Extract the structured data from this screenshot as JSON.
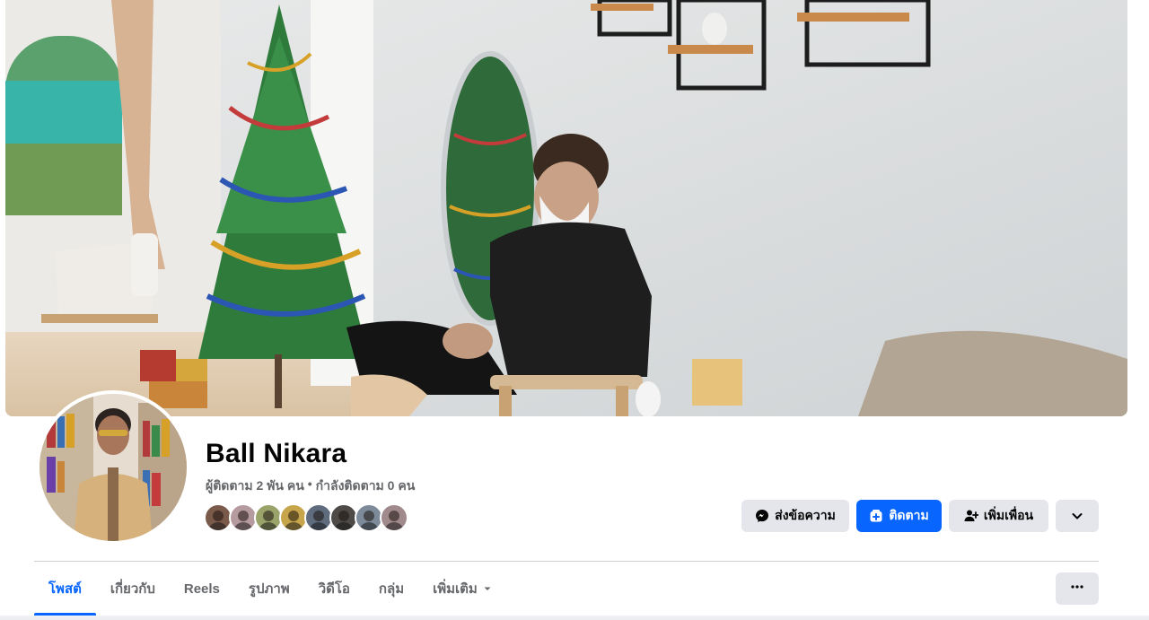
{
  "profile": {
    "name": "Ball Nikara",
    "followers": "ผู้ติดตาม 2 พัน คน",
    "separator": "•",
    "following": "กำลังติดตาม 0 คน"
  },
  "friend_avatars": [
    {
      "color": "#7a5a4a"
    },
    {
      "color": "#b59a9f"
    },
    {
      "color": "#9aa36a"
    },
    {
      "color": "#c7a54a"
    },
    {
      "color": "#5e6c7e"
    },
    {
      "color": "#4d4a48"
    },
    {
      "color": "#7d8a9a"
    },
    {
      "color": "#a08a8c"
    }
  ],
  "actions": {
    "message_label": "ส่งข้อความ",
    "follow_label": "ติดตาม",
    "add_friend_label": "เพิ่มเพื่อน"
  },
  "tabs": [
    {
      "label": "โพสต์",
      "active": true
    },
    {
      "label": "เกี่ยวกับ",
      "active": false
    },
    {
      "label": "Reels",
      "active": false
    },
    {
      "label": "รูปภาพ",
      "active": false
    },
    {
      "label": "วิดีโอ",
      "active": false
    },
    {
      "label": "กลุ่ม",
      "active": false
    },
    {
      "label": "เพิ่มเติม",
      "active": false
    }
  ],
  "icons": {
    "message": "messenger-icon",
    "follow": "follow-icon",
    "add_friend": "add-friend-icon",
    "chevron": "chevron-down-icon",
    "more": "more-dots-icon",
    "caret": "caret-down-icon"
  },
  "colors": {
    "primary": "#0866ff",
    "secondary_bg": "#e4e6eb",
    "secondary_text": "#65676b",
    "text": "#050505"
  }
}
